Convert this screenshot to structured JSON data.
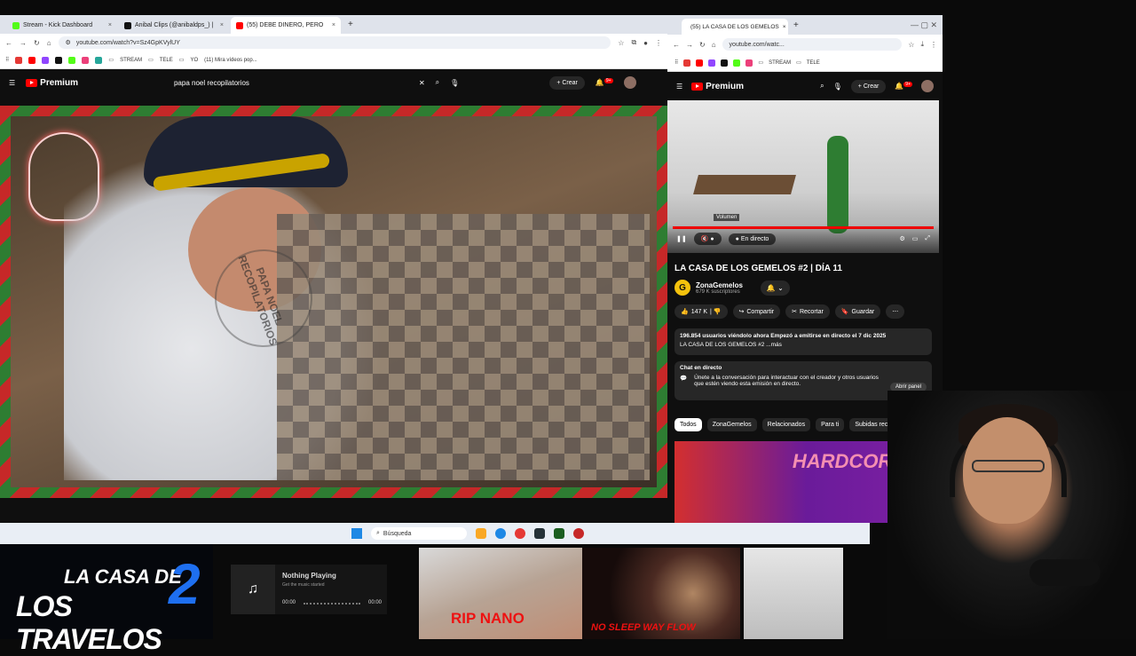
{
  "left_browser": {
    "tabs": [
      {
        "label": "Stream - Kick Dashboard",
        "color": "#53fc18"
      },
      {
        "label": "Anibal Clips (@anibaldps_) |",
        "color": "#111111"
      },
      {
        "label": "(55) DEBE DINERO, PERO",
        "color": "#ff0000"
      }
    ],
    "url": "youtube.com/watch?v=Sz4GpKVylUY",
    "bookmarks": [
      "STREAM",
      "TELE",
      "YO",
      "(11) Mira vídeos pop..."
    ],
    "search_query": "papa noel recopilatorios",
    "logo": "Premium",
    "create_label": "Crear",
    "notif_count": "9+",
    "watermark": "PAPA NOEL RECOPILATORIOS"
  },
  "right_browser": {
    "tab_label": "(55) LA CASA DE LOS GEMELOS",
    "url": "youtube.com/watc...",
    "bookmarks": [
      "STREAM",
      "TELE"
    ],
    "logo": "Premium",
    "create_label": "Crear",
    "notif_count": "9+",
    "volume_tooltip": "Volumen",
    "live_label": "En directo",
    "video_title": "LA CASA DE LOS GEMELOS #2 | DÍA 11",
    "channel_name": "ZonaGemelos",
    "subscribers": "679 K suscriptores",
    "likes": "147 K",
    "share": "Compartir",
    "clip": "Recortar",
    "save": "Guardar",
    "desc_line1": "196.854 usuarios viéndolo ahora  Empezó a emitirse en directo el 7 dic 2025",
    "desc_line2": "LA CASA DE LOS GEMELOS #2 ...más",
    "chat_title": "Chat en directo",
    "chat_text": "Únete a la conversación para interactuar con el creador y otros usuarios que estén viendo esta emisión en directo.",
    "chat_button": "Abrir panel",
    "chips": [
      "Todos",
      "ZonaGemelos",
      "Relacionados",
      "Para ti",
      "Subidas recientes"
    ],
    "thumb_text": "HARDCORE"
  },
  "taskbar": {
    "search_placeholder": "Búsqueda"
  },
  "overlay": {
    "brand_line1": "LA CASA DE",
    "brand_line2": "LOS TRAVELOS",
    "brand_num": "2",
    "player_title": "Nothing Playing",
    "player_sub": "Get the music started",
    "time_start": "00:00",
    "time_end": "00:00",
    "pic1_text": "RIP NANO",
    "pic2_text": "NO SLEEP WAY FLOW"
  }
}
